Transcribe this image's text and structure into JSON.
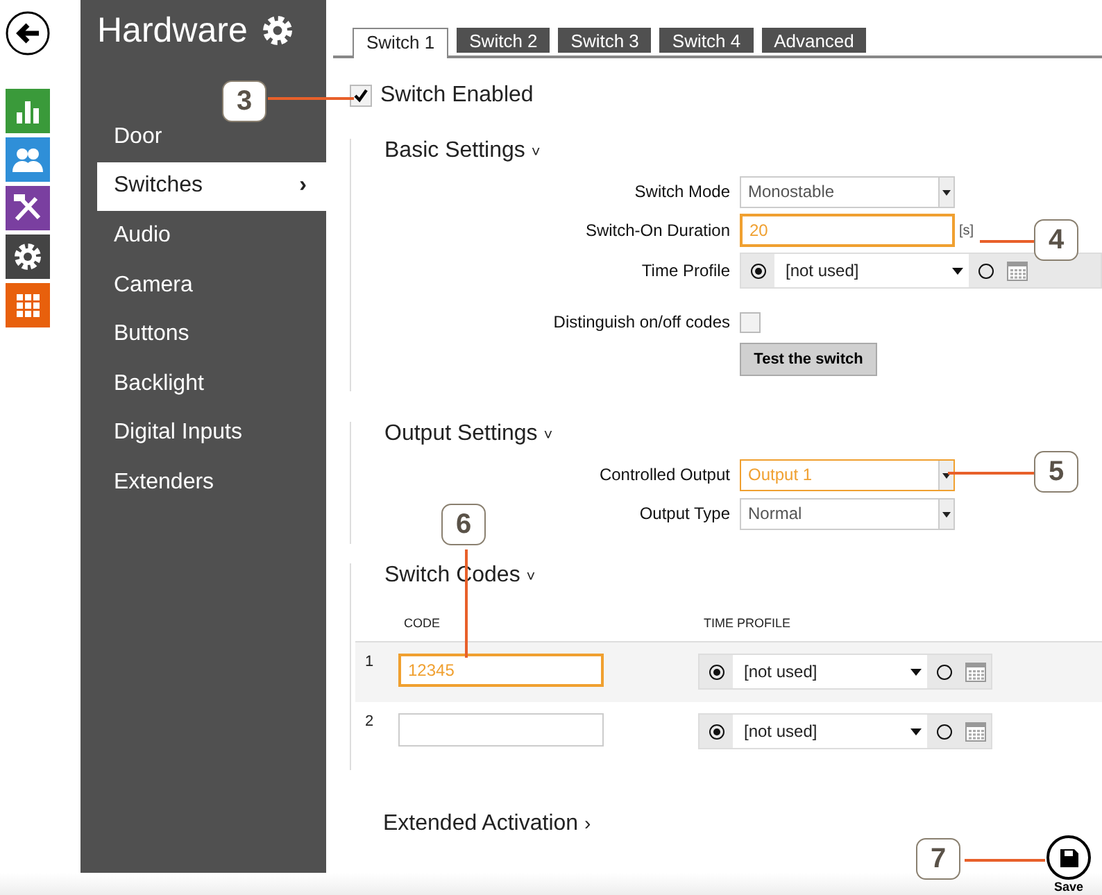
{
  "app_nav": [
    {
      "kind": "chart",
      "color": "#3a9a3a"
    },
    {
      "kind": "users",
      "color": "#2f8fd8"
    },
    {
      "kind": "tools",
      "color": "#7a3fa0"
    },
    {
      "kind": "gear",
      "color": "#444444"
    },
    {
      "kind": "grid",
      "color": "#e8600c"
    }
  ],
  "sidebar": {
    "title": "Hardware",
    "items": [
      {
        "label": "Door",
        "selected": false
      },
      {
        "label": "Switches",
        "selected": true,
        "arrow": "›"
      },
      {
        "label": "Audio",
        "selected": false
      },
      {
        "label": "Camera",
        "selected": false
      },
      {
        "label": "Buttons",
        "selected": false
      },
      {
        "label": "Backlight",
        "selected": false
      },
      {
        "label": "Digital Inputs",
        "selected": false
      },
      {
        "label": "Extenders",
        "selected": false
      }
    ]
  },
  "tabs": [
    {
      "label": "Switch 1",
      "selected": true
    },
    {
      "label": "Switch 2",
      "selected": false
    },
    {
      "label": "Switch 3",
      "selected": false
    },
    {
      "label": "Switch 4",
      "selected": false
    },
    {
      "label": "Advanced",
      "selected": false
    }
  ],
  "switch_enabled": {
    "label": "Switch Enabled",
    "checked": true
  },
  "basic_settings": {
    "title": "Basic Settings",
    "caret": "˅",
    "fields": [
      {
        "kind": "select",
        "label": "Switch Mode",
        "value": "Monostable",
        "highlighted": false
      },
      {
        "kind": "text",
        "label": "Switch-On Duration",
        "value": "20",
        "unit": "[s]",
        "highlighted": true
      },
      {
        "kind": "time_profile",
        "label": "Time Profile",
        "value": "[not used]",
        "profile_selected": true
      },
      {
        "kind": "checkbox",
        "label": "Distinguish on/off codes",
        "checked": false
      },
      {
        "kind": "button",
        "label": "Test the switch"
      }
    ]
  },
  "output_settings": {
    "title": "Output Settings",
    "caret": "˅",
    "fields": [
      {
        "kind": "select",
        "label": "Controlled Output",
        "value": "Output 1",
        "highlighted": true
      },
      {
        "kind": "select",
        "label": "Output Type",
        "value": "Normal",
        "highlighted": false
      }
    ]
  },
  "switch_codes": {
    "title": "Switch Codes",
    "caret": "˅",
    "columns": [
      "CODE",
      "TIME PROFILE"
    ],
    "rows": [
      {
        "number": "1",
        "code": "12345",
        "highlighted": true,
        "time_profile": "[not used]",
        "profile_selected": true
      },
      {
        "number": "2",
        "code": "",
        "highlighted": false,
        "time_profile": "[not used]",
        "profile_selected": true
      }
    ]
  },
  "extended_activation": {
    "title": "Extended Activation",
    "caret": "›"
  },
  "save": {
    "label": "Save"
  },
  "callouts": [
    "3",
    "4",
    "5",
    "6",
    "7"
  ]
}
